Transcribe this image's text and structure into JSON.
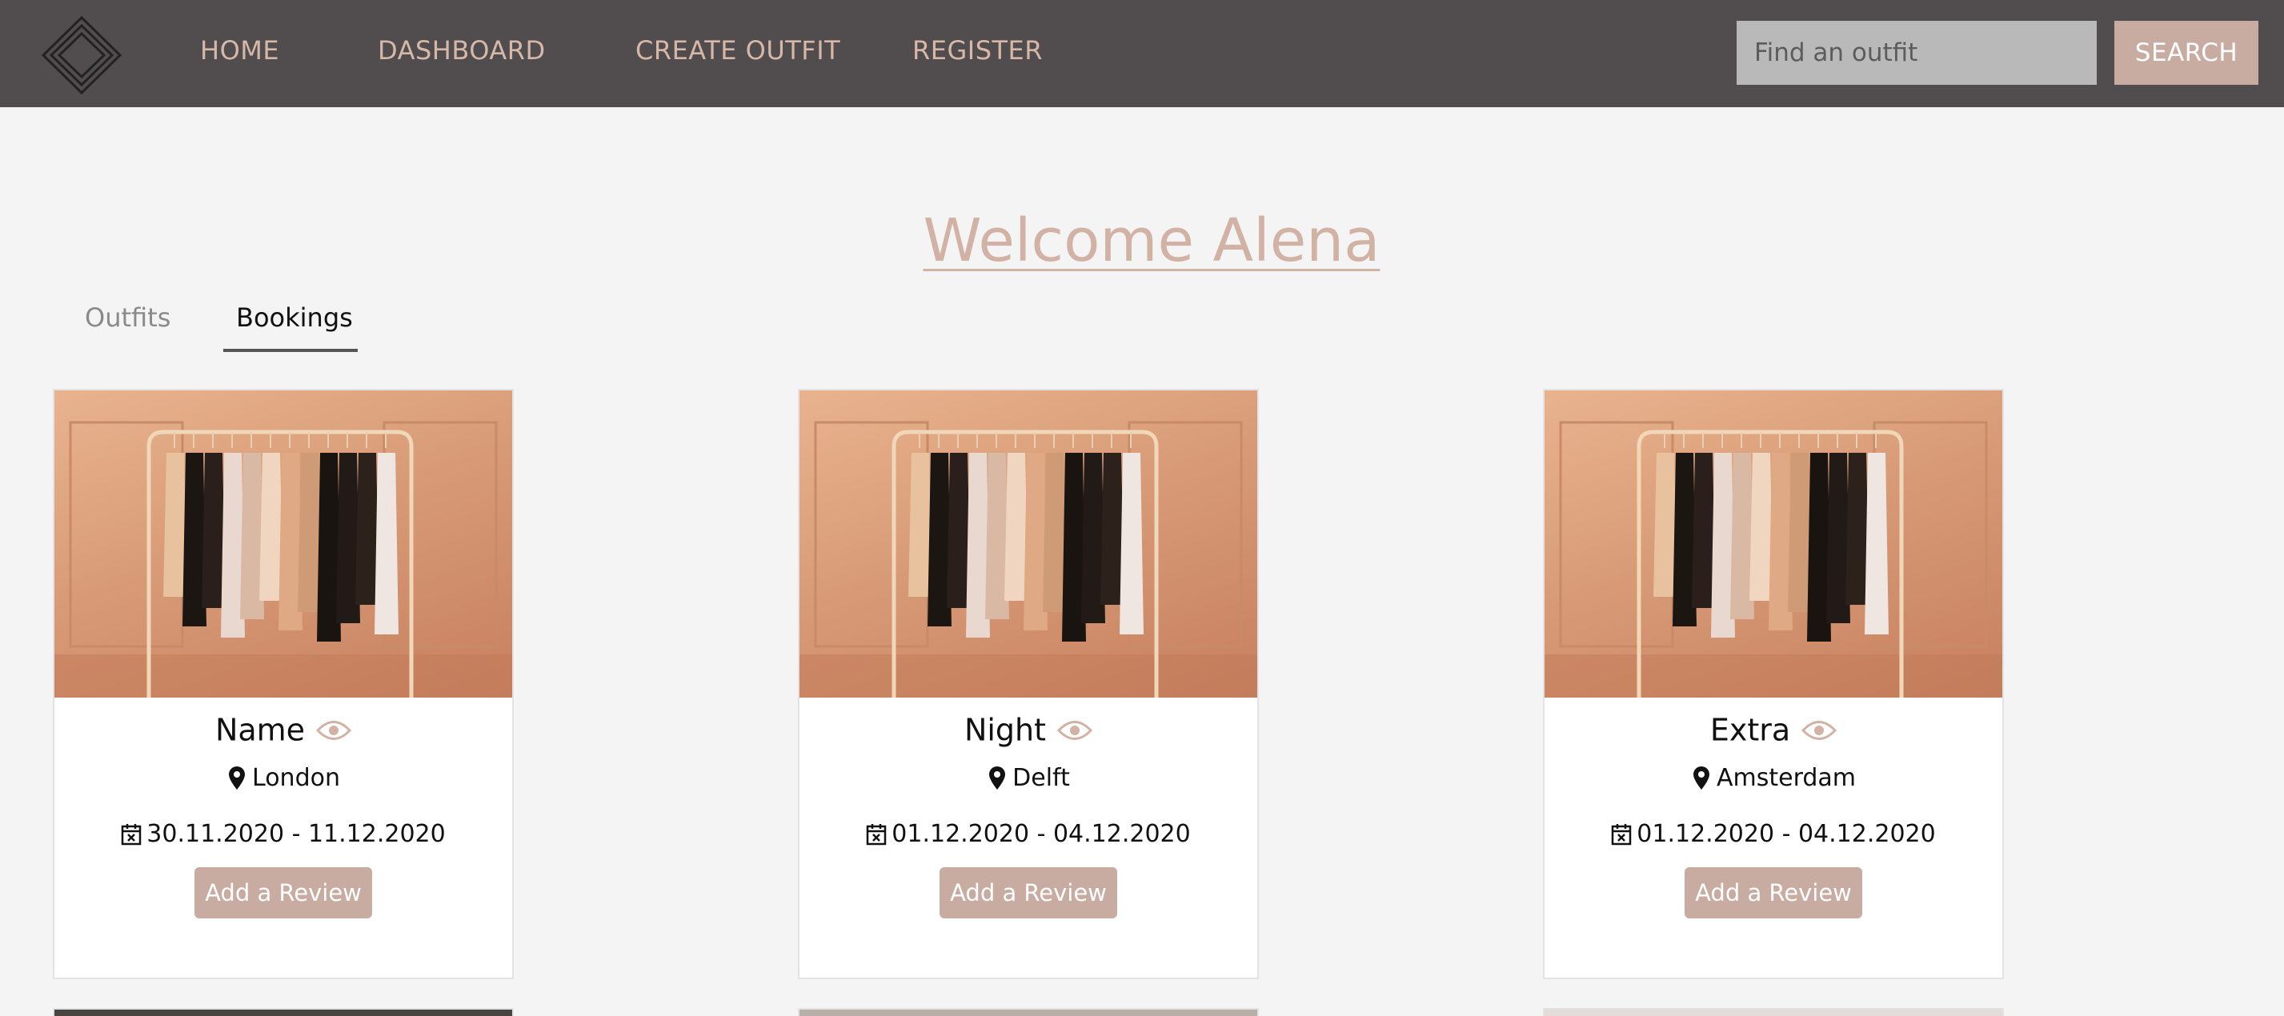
{
  "nav": {
    "links": [
      "HOME",
      "DASHBOARD",
      "CREATE OUTFIT",
      "REGISTER"
    ],
    "search_placeholder": "Find an outfit",
    "search_label": "SEARCH"
  },
  "welcome": "Welcome Alena",
  "tabs": [
    "Outfits",
    "Bookings"
  ],
  "active_tab": "Bookings",
  "cards": [
    {
      "title": "Name",
      "location": "London",
      "dates": "30.11.2020 - 11.12.2020",
      "button": "Add a Review"
    },
    {
      "title": "Night",
      "location": "Delft",
      "dates": "01.12.2020 - 04.12.2020",
      "button": "Add a Review"
    },
    {
      "title": "Extra",
      "location": "Amsterdam",
      "dates": "01.12.2020 - 04.12.2020",
      "button": "Add a Review"
    }
  ],
  "colors": {
    "navbar": "#514d4e",
    "accent": "#c8aca2",
    "nav_text": "#d7b8a8",
    "background": "#f4f4f4"
  },
  "icons": {
    "logo": "diamond-logo-icon",
    "view": "eye-icon",
    "location": "map-pin-icon",
    "date": "calendar-x-icon"
  }
}
